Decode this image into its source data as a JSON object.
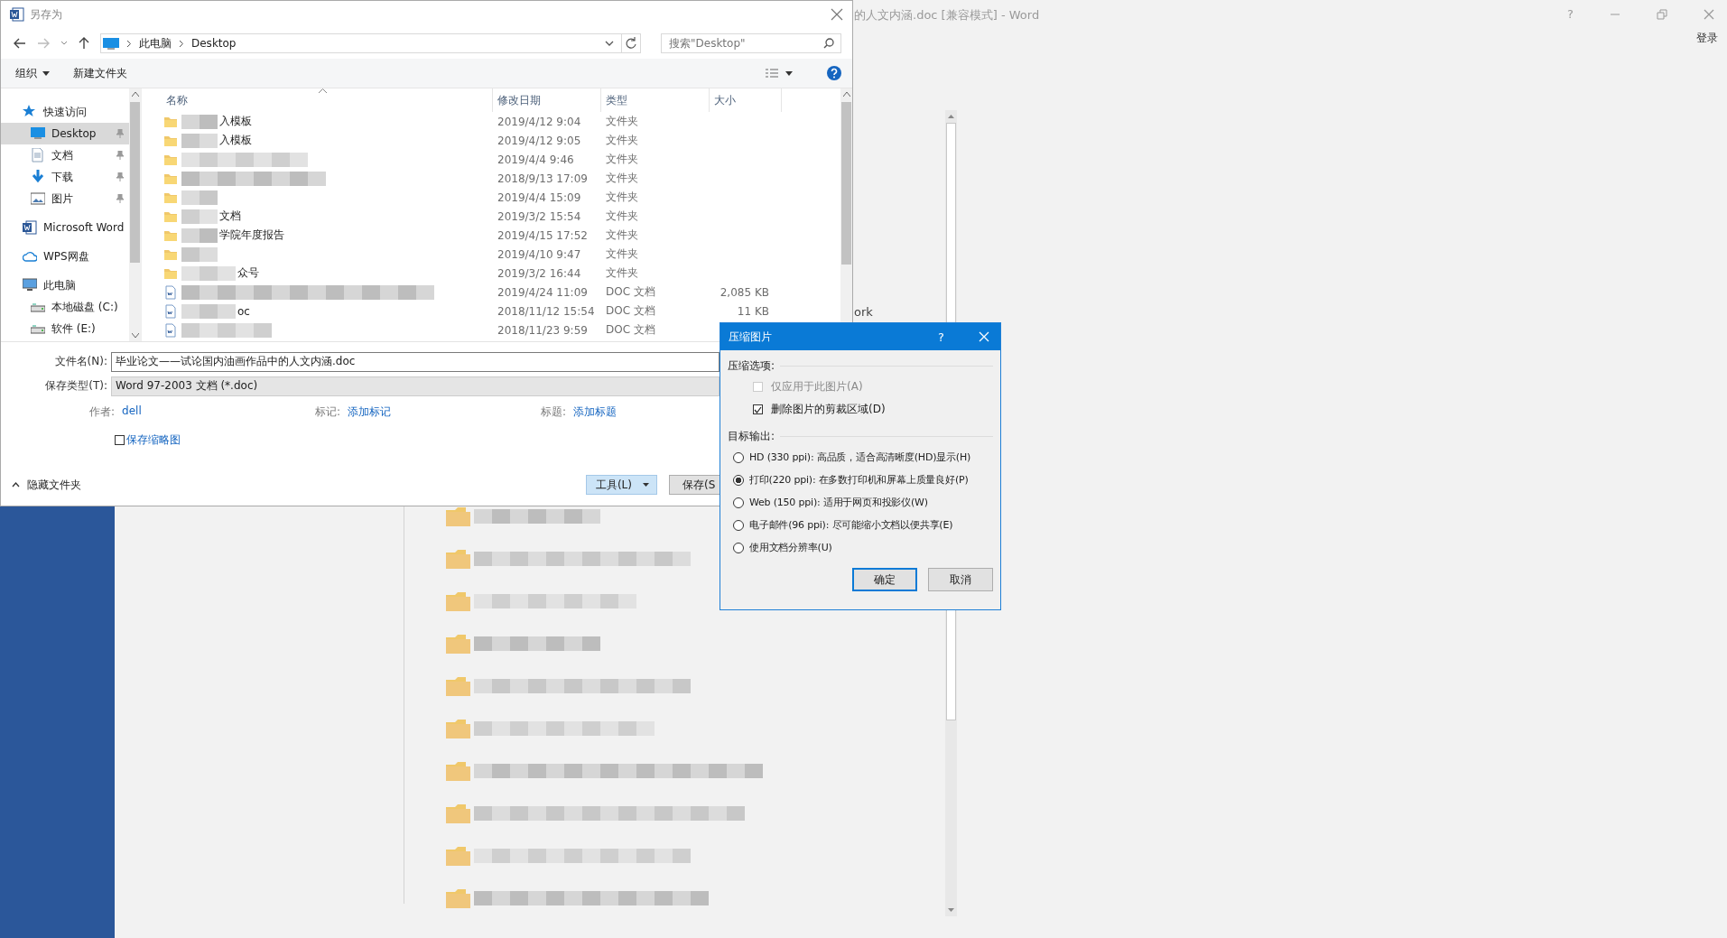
{
  "word_window": {
    "title": "的人文内涵.doc [兼容模式] - Word",
    "help": "?",
    "sign_in": "登录",
    "partial_text": "ork",
    "folders": [
      {
        "kind": "folder"
      },
      {
        "kind": "folder"
      },
      {
        "kind": "folder"
      },
      {
        "kind": "folder"
      },
      {
        "kind": "folder"
      },
      {
        "kind": "folder"
      },
      {
        "kind": "folder"
      },
      {
        "kind": "folder"
      },
      {
        "kind": "folder"
      },
      {
        "kind": "folder"
      }
    ]
  },
  "save_dialog": {
    "title": "另存为",
    "breadcrumb": [
      "此电脑",
      "Desktop"
    ],
    "search": {
      "placeholder": "搜索\"Desktop\""
    },
    "toolbar": {
      "organize": "组织",
      "new_folder": "新建文件夹"
    },
    "sidebar": [
      {
        "label": "快速访问",
        "kind": "star",
        "selected": false,
        "children": [
          {
            "label": "Desktop",
            "kind": "desktop",
            "selected": true,
            "pinned": true
          },
          {
            "label": "文档",
            "kind": "document",
            "selected": false,
            "pinned": true
          },
          {
            "label": "下载",
            "kind": "download",
            "selected": false,
            "pinned": true
          },
          {
            "label": "图片",
            "kind": "picture",
            "selected": false,
            "pinned": true
          }
        ]
      },
      {
        "label": "Microsoft Word",
        "kind": "word",
        "selected": false
      },
      {
        "label": "WPS网盘",
        "kind": "cloud",
        "selected": false
      },
      {
        "label": "此电脑",
        "kind": "pc",
        "selected": false,
        "children": [
          {
            "label": "本地磁盘 (C:)",
            "kind": "drive",
            "selected": false
          },
          {
            "label": "软件 (E:)",
            "kind": "drive",
            "selected": false
          }
        ]
      }
    ],
    "columns": [
      "名称",
      "修改日期",
      "类型",
      "大小"
    ],
    "rows": [
      {
        "kind": "folder",
        "name": "入模板",
        "modified": "2019/4/12 9:04",
        "type": "文件夹"
      },
      {
        "kind": "folder",
        "name": "入模板",
        "modified": "2019/4/12 9:05",
        "type": "文件夹"
      },
      {
        "kind": "folder",
        "modified": "2019/4/4 9:46",
        "type": "文件夹"
      },
      {
        "kind": "folder",
        "modified": "2018/9/13 17:09",
        "type": "文件夹"
      },
      {
        "kind": "folder",
        "modified": "2019/4/4 15:09",
        "type": "文件夹"
      },
      {
        "kind": "folder",
        "name": "文档",
        "modified": "2019/3/2 15:54",
        "type": "文件夹"
      },
      {
        "kind": "folder",
        "name": "学院年度报告",
        "modified": "2019/4/15 17:52",
        "type": "文件夹"
      },
      {
        "kind": "folder",
        "modified": "2019/4/10 9:47",
        "type": "文件夹"
      },
      {
        "kind": "folder",
        "name": "众号",
        "modified": "2019/3/2 16:44",
        "type": "文件夹"
      },
      {
        "kind": "doc",
        "modified": "2019/4/24 11:09",
        "type": "DOC 文档",
        "size": "2,085 KB"
      },
      {
        "kind": "doc",
        "name": "oc",
        "modified": "2018/11/12 15:54",
        "type": "DOC 文档",
        "size": "11 KB"
      },
      {
        "kind": "doc",
        "modified": "2018/11/23 9:59",
        "type": "DOC 文档"
      }
    ],
    "file_name": {
      "label": "文件名(N):",
      "value": "毕业论文——试论国内油画作品中的人文内涵.doc"
    },
    "save_type": {
      "label": "保存类型(T):",
      "value": "Word 97-2003 文档 (*.doc)"
    },
    "meta": [
      {
        "label": "作者:",
        "value": "dell"
      },
      {
        "label": "标记:",
        "value": "添加标记"
      },
      {
        "label": "标题:",
        "value": "添加标题"
      }
    ],
    "thumbnail": {
      "label": "保存缩略图",
      "checked": false
    },
    "hide_folders": "隐藏文件夹",
    "tools_button": "工具(L)",
    "save_button": "保存(S"
  },
  "compress_dialog": {
    "title": "压缩图片",
    "help": "?",
    "options_heading": "压缩选项:",
    "options": [
      {
        "label": "仅应用于此图片(A)",
        "checked": false,
        "disabled": true
      },
      {
        "label": "删除图片的剪裁区域(D)",
        "checked": true,
        "disabled": false
      }
    ],
    "output_heading": "目标输出:",
    "resolutions": [
      {
        "label": "HD (330 ppi): 高品质，适合高清晰度(HD)显示(H)",
        "selected": false
      },
      {
        "label": "打印(220 ppi): 在多数打印机和屏幕上质量良好(P)",
        "selected": true
      },
      {
        "label": "Web (150 ppi): 适用于网页和投影仪(W)",
        "selected": false
      },
      {
        "label": "电子邮件(96 ppi): 尽可能缩小文档以便共享(E)",
        "selected": false
      },
      {
        "label": "使用文档分辨率(U)",
        "selected": false
      }
    ],
    "buttons": [
      {
        "label": "确定",
        "default": true
      },
      {
        "label": "取消",
        "default": false
      }
    ]
  }
}
